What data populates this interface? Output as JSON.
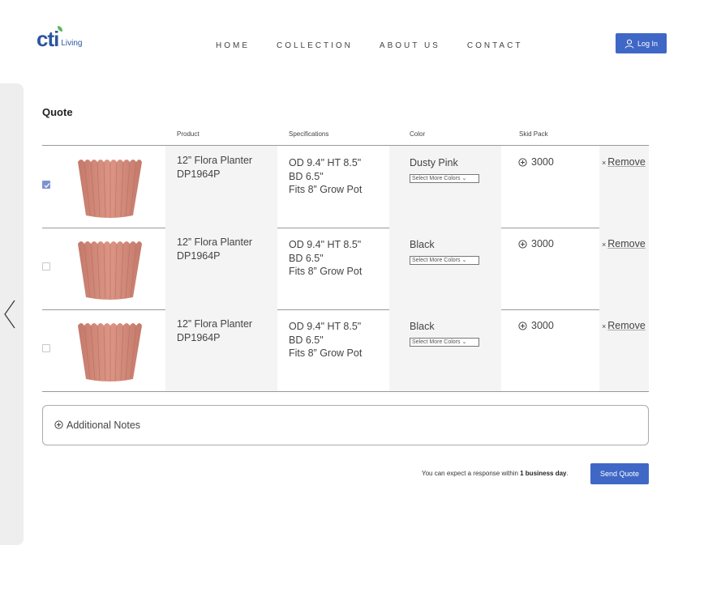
{
  "brand": {
    "logo_text": "cti",
    "logo_sub": "Living",
    "color": "#2c55a0",
    "leaf_color": "#5cb85c"
  },
  "nav": {
    "items": [
      "HOME",
      "COLLECTION",
      "ABOUT US",
      "CONTACT"
    ]
  },
  "header": {
    "login_label": "Log In",
    "login_icon": "user-icon"
  },
  "side_panel": {
    "icon": "chevron-left-icon"
  },
  "quote": {
    "title": "Quote",
    "columns": [
      "Product",
      "Specifications",
      "Color",
      "Skid Pack"
    ],
    "rows": [
      {
        "checked": true,
        "product_name": "12” Flora Planter",
        "sku": "DP1964P",
        "spec_od_ht": "OD 9.4\" HT 8.5\"",
        "spec_bd": "BD 6.5\"",
        "spec_fits": "Fits 8” Grow Pot",
        "color": "Dusty Pink",
        "select_more": "Select More Colors",
        "qty": "3000",
        "remove_label": "Remove"
      },
      {
        "checked": false,
        "product_name": "12” Flora Planter",
        "sku": "DP1964P",
        "spec_od_ht": "OD 9.4\" HT 8.5\"",
        "spec_bd": "BD 6.5\"",
        "spec_fits": "Fits 8” Grow Pot",
        "color": "Black",
        "select_more": "Select More Colors",
        "qty": "3000",
        "remove_label": "Remove"
      },
      {
        "checked": false,
        "product_name": "12” Flora Planter",
        "sku": "DP1964P",
        "spec_od_ht": "OD 9.4\" HT 8.5\"",
        "spec_bd": "BD 6.5\"",
        "spec_fits": "Fits 8” Grow Pot",
        "color": "Black",
        "select_more": "Select More Colors",
        "qty": "3000",
        "remove_label": "Remove"
      }
    ],
    "notes_label": "Additional Notes",
    "expect_text": "You can expect a response within ",
    "expect_bold": "1 business day",
    "expect_end": ".",
    "send_label": "Send Quote"
  },
  "colors": {
    "accent": "#3f67c6",
    "checkbox_checked": "#7b93d1",
    "pot": "#d28b7c"
  }
}
